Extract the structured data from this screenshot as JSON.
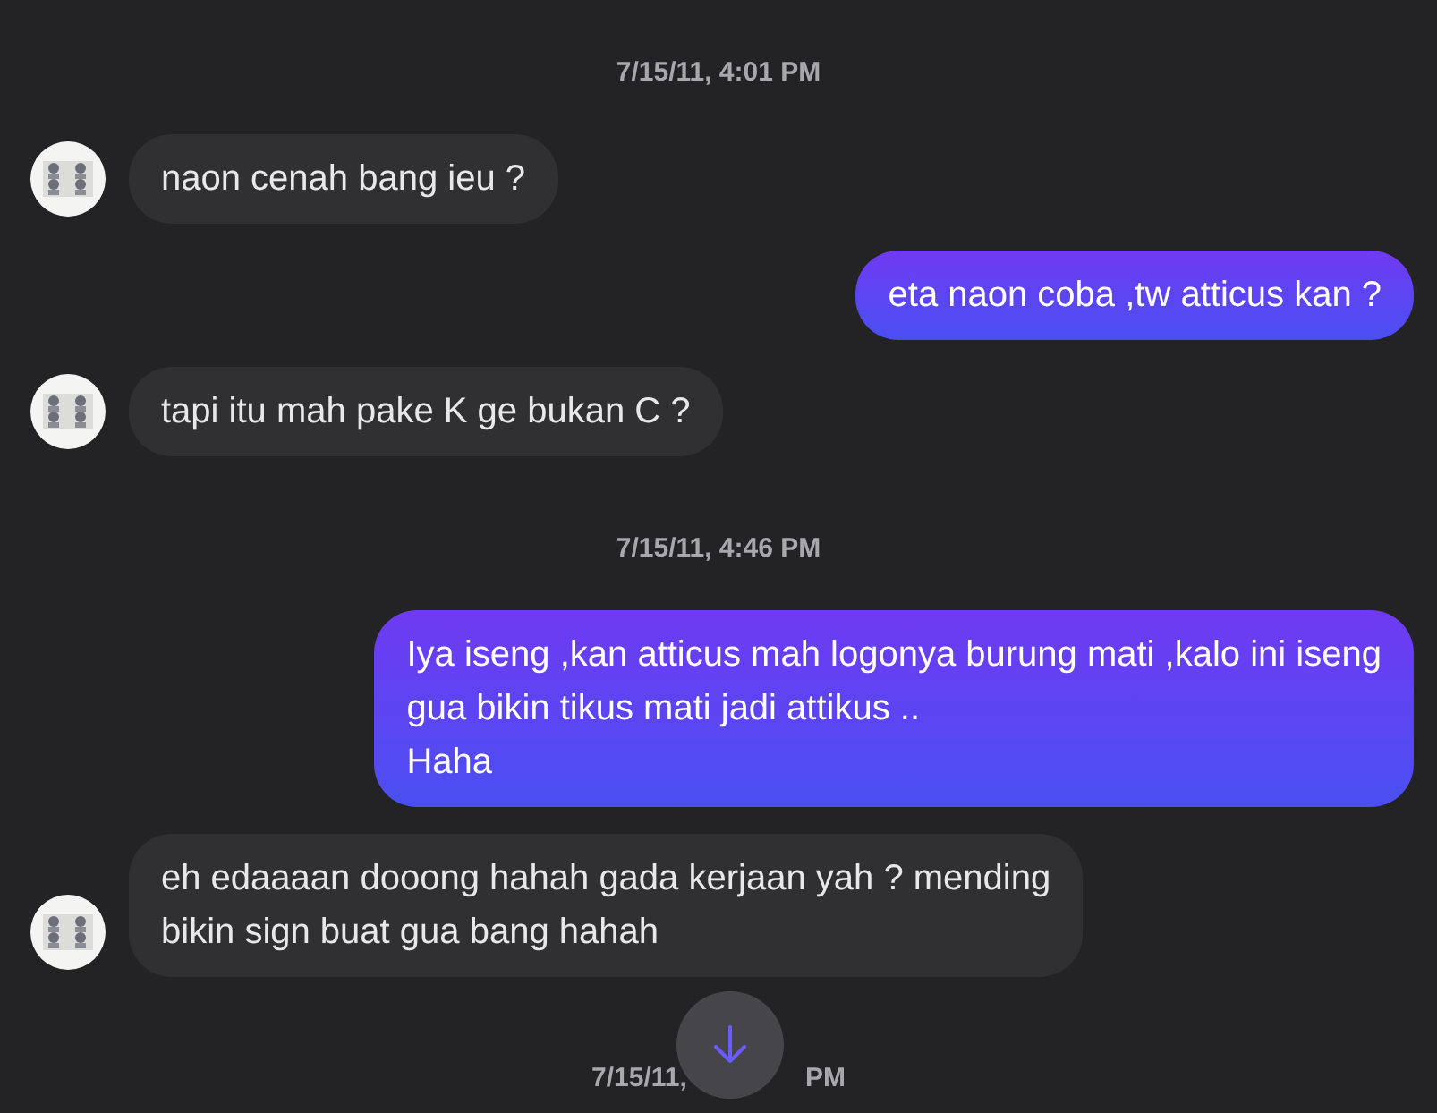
{
  "messages": [
    {
      "kind": "timestamp",
      "text": "7/15/11, 4:01 PM"
    },
    {
      "kind": "incoming",
      "lines": [
        "naon cenah bang ieu ?"
      ],
      "avatar": true
    },
    {
      "kind": "outgoing",
      "lines": [
        "eta naon coba ,tw atticus kan ?"
      ]
    },
    {
      "kind": "incoming",
      "lines": [
        "tapi itu mah pake K ge bukan C ?"
      ],
      "avatar": true
    },
    {
      "kind": "timestamp",
      "text": "7/15/11, 4:46 PM"
    },
    {
      "kind": "outgoing",
      "lines": [
        "Iya iseng ,kan atticus mah logonya burung mati ,kalo ini iseng",
        "gua bikin tikus mati jadi attikus ..",
        "Haha"
      ]
    },
    {
      "kind": "incoming",
      "lines": [
        "eh edaaaan dooong hahah gada kerjaan yah ? mending",
        "bikin sign buat gua bang hahah"
      ],
      "avatar": true
    },
    {
      "kind": "covered_timestamp",
      "parts": [
        "7/15/11,",
        "PM"
      ]
    }
  ]
}
